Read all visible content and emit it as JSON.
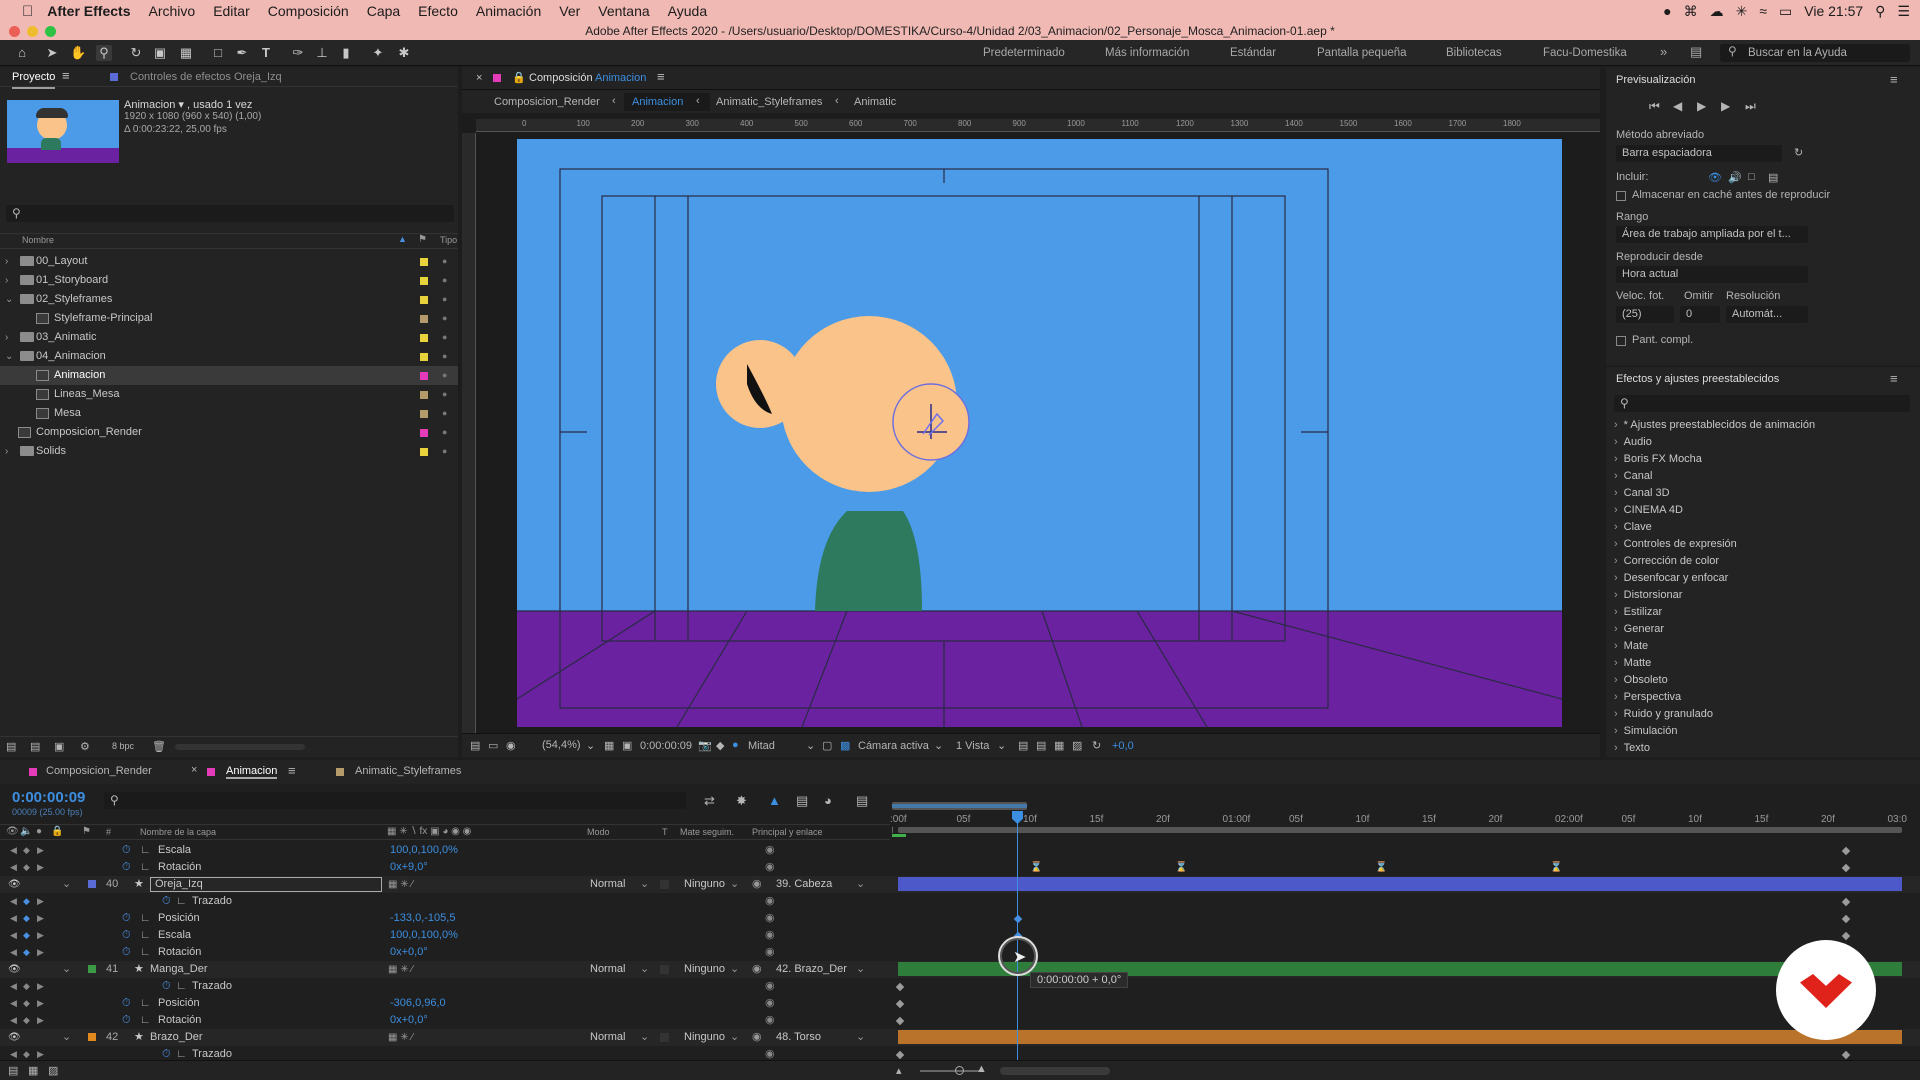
{
  "menubar": {
    "app": "After Effects",
    "items": [
      "Archivo",
      "Editar",
      "Composición",
      "Capa",
      "Efecto",
      "Animación",
      "Ver",
      "Ventana",
      "Ayuda"
    ],
    "clock": "Vie 21:57"
  },
  "window_title": "Adobe After Effects 2020 - /Users/usuario/Desktop/DOMESTIKA/Curso-4/Unidad 2/03_Animacion/02_Personaje_Mosca_Animacion-01.aep *",
  "workspaces": [
    "Predeterminado",
    "Más información",
    "Estándar",
    "Pantalla pequeña",
    "Bibliotecas",
    "Facu-Domestika"
  ],
  "help_placeholder": "Buscar en la Ayuda",
  "project": {
    "tab": "Proyecto",
    "effects_tab": "Controles de efectos Oreja_Izq",
    "selected": {
      "name": "Animacion ▾ , usado 1 vez",
      "dims": "1920 x 1080  (960 x 540) (1,00)",
      "duration": "Δ 0:00:23:22, 25,00 fps"
    },
    "col_name": "Nombre",
    "col_type": "Tipo",
    "items": [
      {
        "name": "00_Layout",
        "type": "folder",
        "color": "#e8d33a",
        "expanded": false
      },
      {
        "name": "01_Storyboard",
        "type": "folder",
        "color": "#e8d33a",
        "expanded": false
      },
      {
        "name": "02_Styleframes",
        "type": "folder",
        "color": "#e8d33a",
        "expanded": true
      },
      {
        "name": "Styleframe-Principal",
        "type": "comp",
        "color": "#b59a6a",
        "indent": 1
      },
      {
        "name": "03_Animatic",
        "type": "folder",
        "color": "#e8d33a",
        "expanded": false
      },
      {
        "name": "04_Animacion",
        "type": "folder",
        "color": "#e8d33a",
        "expanded": true
      },
      {
        "name": "Animacion",
        "type": "comp",
        "color": "#e43bb9",
        "indent": 1,
        "selected": true
      },
      {
        "name": "Lineas_Mesa",
        "type": "comp",
        "color": "#b59a6a",
        "indent": 1
      },
      {
        "name": "Mesa",
        "type": "comp",
        "color": "#b59a6a",
        "indent": 1
      },
      {
        "name": "Composicion_Render",
        "type": "comp",
        "color": "#e43bb9",
        "indent": 0
      },
      {
        "name": "Solids",
        "type": "folder",
        "color": "#e8d33a",
        "expanded": false
      }
    ],
    "bpc": "8 bpc"
  },
  "comp": {
    "tab_prefix": "Composición",
    "tab_name": "Animacion",
    "breadcrumbs": [
      "Composicion_Render",
      "Animacion",
      "Animatic_Styleframes",
      "Animatic"
    ],
    "ruler": [
      "0",
      "100",
      "200",
      "300",
      "400",
      "500",
      "600",
      "700",
      "800",
      "900",
      "1000",
      "1100",
      "1200",
      "1300",
      "1400",
      "1500",
      "1600",
      "1700",
      "1800"
    ],
    "footer": {
      "zoom": "(54,4%)",
      "time": "0:00:00:09",
      "resolution": "Mitad",
      "camera": "Cámara activa",
      "views": "1 Vista",
      "exposure": "+0,0"
    },
    "colors": {
      "sky": "#4b9be8",
      "floor": "#6a22a0",
      "face": "#f9c38a",
      "body": "#2e7a5e"
    }
  },
  "preview": {
    "title": "Previsualización",
    "shortcut_label": "Método abreviado",
    "shortcut": "Barra espaciadora",
    "include": "Incluir:",
    "cache": "Almacenar en caché antes de reproducir",
    "range_label": "Rango",
    "range": "Área de trabajo ampliada por el t...",
    "from_label": "Reproducir desde",
    "from": "Hora actual",
    "fps_label": "Veloc. fot.",
    "skip_label": "Omitir",
    "res_label": "Resolución",
    "fps": "(25)",
    "skip": "0",
    "res": "Automát...",
    "fullscreen": "Pant. compl."
  },
  "effects_presets": {
    "title": "Efectos y ajustes preestablecidos",
    "items": [
      "* Ajustes preestablecidos de animación",
      "Audio",
      "Boris FX Mocha",
      "Canal",
      "Canal 3D",
      "CINEMA 4D",
      "Clave",
      "Controles de expresión",
      "Corrección de color",
      "Desenfocar y enfocar",
      "Distorsionar",
      "Estilizar",
      "Generar",
      "Mate",
      "Matte",
      "Obsoleto",
      "Perspectiva",
      "Ruido y granulado",
      "Simulación",
      "Texto"
    ]
  },
  "timeline": {
    "tabs": [
      "Composicion_Render",
      "Animacion",
      "Animatic_Styleframes"
    ],
    "timecode": "0:00:00:09",
    "timecode_sub": "00009 (25.00 fps)",
    "headers": {
      "layer": "Nombre de la capa",
      "mode": "Modo",
      "t": "T",
      "matte": "Mate seguim.",
      "parent": "Principal y enlace"
    },
    "ruler": [
      ":00f",
      "05f",
      "10f",
      "15f",
      "20f",
      "01:00f",
      "05f",
      "10f",
      "15f",
      "20f",
      "02:00f",
      "05f",
      "10f",
      "15f",
      "20f",
      "03:0"
    ],
    "rows": [
      {
        "kind": "prop",
        "label": "Escala",
        "value": "100,0,100,0%"
      },
      {
        "kind": "prop",
        "label": "Rotación",
        "value": "0x+9,0°"
      },
      {
        "kind": "layer",
        "num": "40",
        "name": "Oreja_Izq",
        "mode": "Normal",
        "matte": "Ninguno",
        "parent": "39. Cabeza",
        "color": "#5b6bd6"
      },
      {
        "kind": "prop",
        "label": "Trazado",
        "value": ""
      },
      {
        "kind": "prop",
        "label": "Posición",
        "value": "-133,0,-105,5"
      },
      {
        "kind": "prop",
        "label": "Escala",
        "value": "100,0,100,0%"
      },
      {
        "kind": "prop",
        "label": "Rotación",
        "value": "0x+0,0°"
      },
      {
        "kind": "layer",
        "num": "41",
        "name": "Manga_Der",
        "mode": "Normal",
        "matte": "Ninguno",
        "parent": "42. Brazo_Der",
        "color": "#3c9a47"
      },
      {
        "kind": "prop",
        "label": "Trazado",
        "value": ""
      },
      {
        "kind": "prop",
        "label": "Posición",
        "value": "-306,0,96,0"
      },
      {
        "kind": "prop",
        "label": "Rotación",
        "value": "0x+0,0°"
      },
      {
        "kind": "layer",
        "num": "42",
        "name": "Brazo_Der",
        "mode": "Normal",
        "matte": "Ninguno",
        "parent": "48. Torso",
        "color": "#e08a1e"
      },
      {
        "kind": "prop",
        "label": "Trazado",
        "value": ""
      }
    ],
    "tooltip": "0:00:00:00 + 0,0°"
  }
}
